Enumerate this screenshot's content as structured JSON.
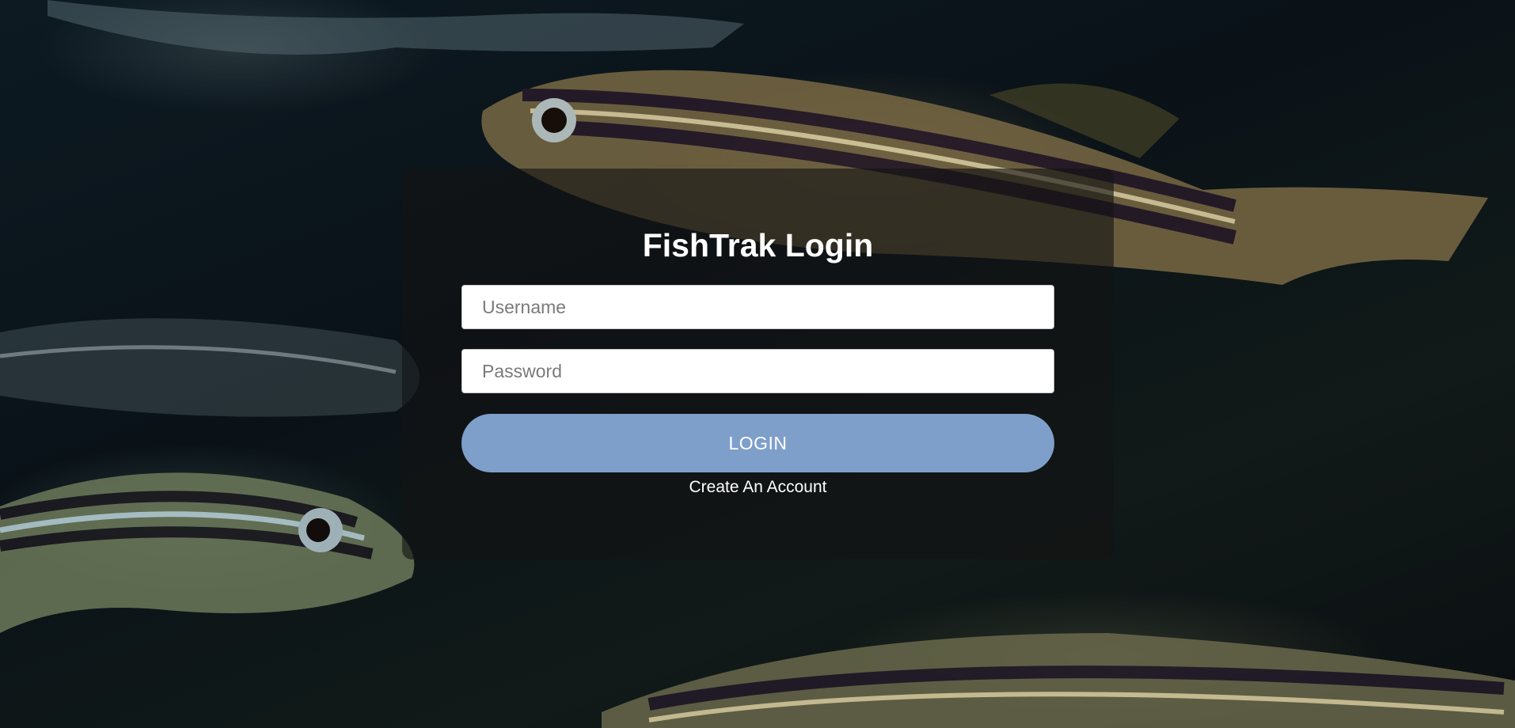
{
  "page": {
    "background_image": "zebrafish-photo",
    "colors": {
      "panel_overlay": "#141414",
      "button": "#7f9fcb",
      "text": "#ffffff"
    }
  },
  "login": {
    "title": "FishTrak Login",
    "username": {
      "placeholder": "Username",
      "value": ""
    },
    "password": {
      "placeholder": "Password",
      "value": ""
    },
    "login_label": "LOGIN",
    "create_account_label": "Create An Account"
  }
}
